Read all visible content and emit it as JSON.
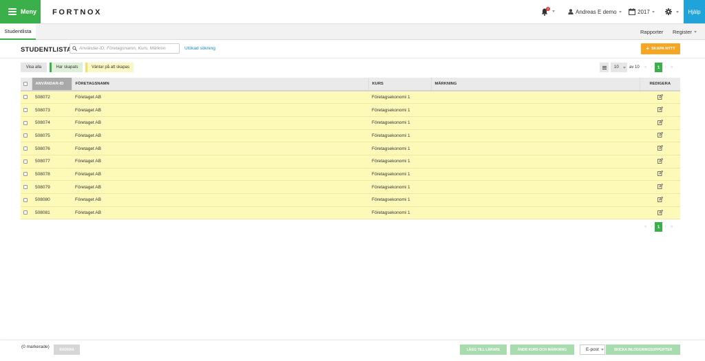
{
  "header": {
    "menu_label": "Meny",
    "logo_text": "FORTNOX",
    "notification_count": "2",
    "user_name": "Andreas E demo",
    "year": "2017",
    "help_label": "Hjälp"
  },
  "subnav": {
    "active_tab": "Studentlista",
    "right_items": [
      "Rapporter",
      "Register"
    ]
  },
  "toolbar": {
    "page_title": "STUDENTLISTA",
    "search_placeholder": "Användar-ID, Företagsnamn, Kurs, Märknin",
    "advanced_search": "Utökad sökning",
    "create_label": "SKAPA NYTT"
  },
  "filters": [
    {
      "label": "Visa alla",
      "color": "#e6e6e6"
    },
    {
      "label": "Har skapats",
      "color": "#dff0d8"
    },
    {
      "label": "Väntar på att skapas",
      "color": "#fcf8c3"
    }
  ],
  "pagination": {
    "per_page": "10",
    "of_label": "av 10",
    "first": "«",
    "prev": "‹",
    "current_page": "1",
    "next": "›",
    "last": "»"
  },
  "table": {
    "columns": [
      "ANVÄNDAR-ID",
      "FÖRETAGSNAMN",
      "KURS",
      "MÄRKNING",
      "REDIGERA"
    ],
    "rows": [
      {
        "id": "508072",
        "company": "Företaget AB",
        "course": "Företagsekonomi 1",
        "marking": ""
      },
      {
        "id": "508073",
        "company": "Företaget AB",
        "course": "Företagsekonomi 1",
        "marking": ""
      },
      {
        "id": "508074",
        "company": "Företaget AB",
        "course": "Företagsekonomi 1",
        "marking": ""
      },
      {
        "id": "508075",
        "company": "Företaget AB",
        "course": "Företagsekonomi 1",
        "marking": ""
      },
      {
        "id": "508076",
        "company": "Företaget AB",
        "course": "Företagsekonomi 1",
        "marking": ""
      },
      {
        "id": "508077",
        "company": "Företaget AB",
        "course": "Företagsekonomi 1",
        "marking": ""
      },
      {
        "id": "508078",
        "company": "Företaget AB",
        "course": "Företagsekonomi 1",
        "marking": ""
      },
      {
        "id": "508079",
        "company": "Företaget AB",
        "course": "Företagsekonomi 1",
        "marking": ""
      },
      {
        "id": "508080",
        "company": "Företaget AB",
        "course": "Företagsekonomi 1",
        "marking": ""
      },
      {
        "id": "508081",
        "company": "Företaget AB",
        "course": "Företagsekonomi 1",
        "marking": ""
      }
    ]
  },
  "bottombar": {
    "marked_label": "(0 markerade)",
    "delete_label": "RADERA",
    "add_teacher_label": "LÄGG TILL LÄRARE",
    "change_course_label": "ÄNDR KURS OCH MÄRKNING",
    "email_option": "E-post",
    "send_label": "SKICKA INLOGGNINGSUPPGIFTER"
  },
  "colors": {
    "brand_green": "#3bb04a",
    "help_blue": "#1fa3d8",
    "create_orange": "#f5a623",
    "row_yellow": "#fcf9b9"
  }
}
